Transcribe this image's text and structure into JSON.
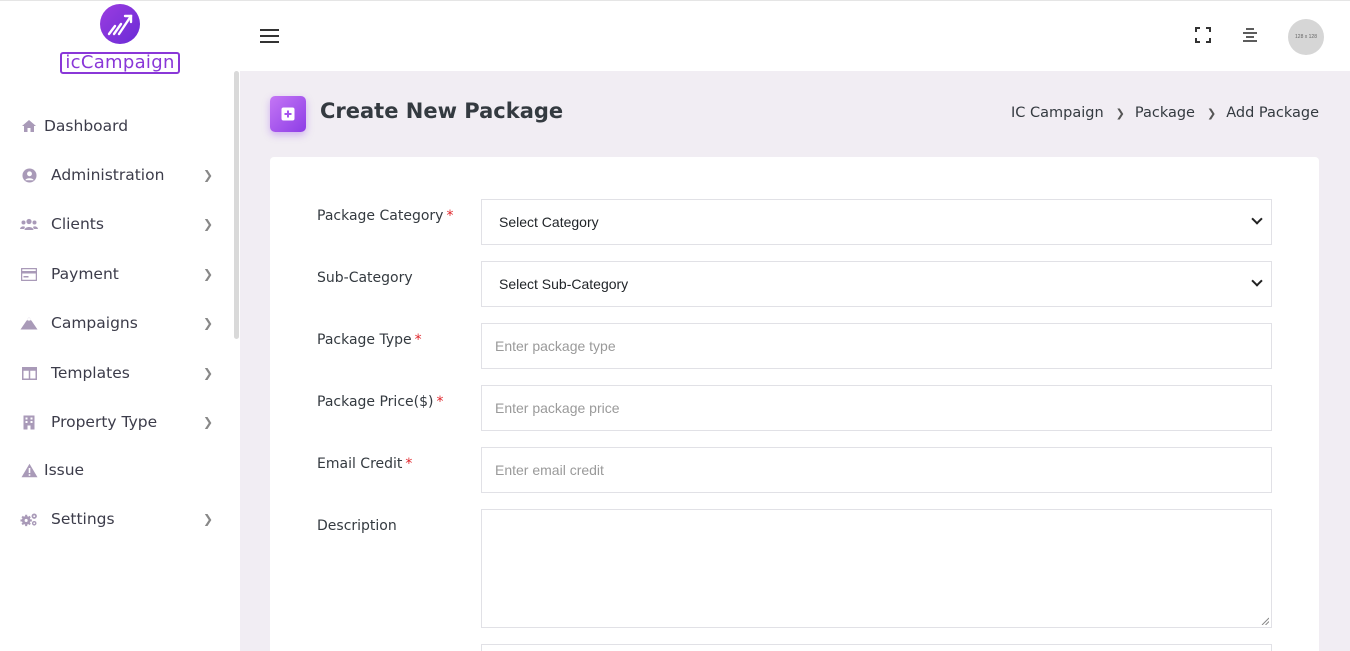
{
  "brand": {
    "name": "icCampaign"
  },
  "sidebar": {
    "items": [
      {
        "label": "Dashboard",
        "icon": "home-icon",
        "has_children": false
      },
      {
        "label": "Administration",
        "icon": "user-circle-icon",
        "has_children": true
      },
      {
        "label": "Clients",
        "icon": "users-icon",
        "has_children": true
      },
      {
        "label": "Payment",
        "icon": "credit-card-icon",
        "has_children": true
      },
      {
        "label": "Campaigns",
        "icon": "mountain-icon",
        "has_children": true
      },
      {
        "label": "Templates",
        "icon": "columns-icon",
        "has_children": true
      },
      {
        "label": "Property Type",
        "icon": "building-icon",
        "has_children": true
      },
      {
        "label": "Issue",
        "icon": "warning-icon",
        "has_children": false
      },
      {
        "label": "Settings",
        "icon": "gears-icon",
        "has_children": true
      }
    ]
  },
  "topbar": {
    "menu_icon": "hamburger-icon",
    "fullscreen_icon": "fullscreen-icon",
    "align_icon": "align-center-icon",
    "avatar_text": "128 x 128"
  },
  "page": {
    "title": "Create New Package",
    "icon": "plus-square-icon",
    "breadcrumb": [
      "IC Campaign",
      "Package",
      "Add Package"
    ]
  },
  "form": {
    "category": {
      "label": "Package Category",
      "required": "*",
      "selected": "Select Category"
    },
    "subcategory": {
      "label": "Sub-Category",
      "selected": "Select Sub-Category"
    },
    "type": {
      "label": "Package Type",
      "required": "*",
      "placeholder": "Enter package type",
      "value": ""
    },
    "price": {
      "label": "Package Price($)",
      "required": "*",
      "placeholder": "Enter package price",
      "value": ""
    },
    "email_credit": {
      "label": "Email Credit",
      "required": "*",
      "placeholder": "Enter email credit",
      "value": ""
    },
    "description": {
      "label": "Description",
      "value": ""
    }
  },
  "colors": {
    "accent": "#8a37d8",
    "required": "#e0242a",
    "page_bg": "#f1edf3",
    "nav_icon": "#a99ab8"
  }
}
